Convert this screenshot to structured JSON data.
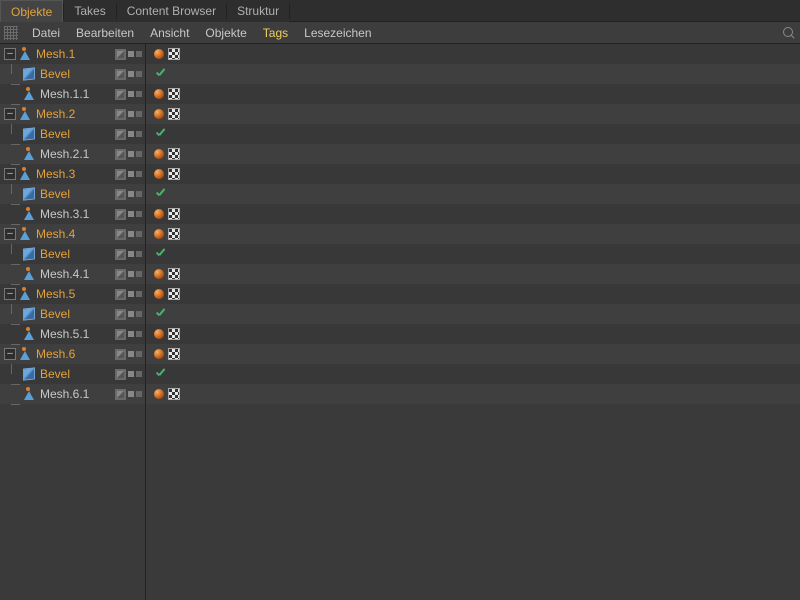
{
  "tabs": [
    {
      "label": "Objekte",
      "active": true
    },
    {
      "label": "Takes",
      "active": false
    },
    {
      "label": "Content Browser",
      "active": false
    },
    {
      "label": "Struktur",
      "active": false
    }
  ],
  "menu": {
    "items": [
      "Datei",
      "Bearbeiten",
      "Ansicht",
      "Objekte",
      "Tags",
      "Lesezeichen"
    ],
    "highlighted_index": 4
  },
  "expander_glyph": "–",
  "objects": [
    {
      "name": "Mesh.1",
      "type": "mesh",
      "depth": 0,
      "selected": true,
      "expanded": true,
      "tags": [
        "phong",
        "uvw"
      ]
    },
    {
      "name": "Bevel",
      "type": "bevel",
      "depth": 1,
      "selected": true,
      "expanded": false,
      "tags": [
        "check"
      ]
    },
    {
      "name": "Mesh.1.1",
      "type": "mesh",
      "depth": 1,
      "selected": false,
      "expanded": false,
      "tags": [
        "phong",
        "uvw"
      ],
      "last": true
    },
    {
      "name": "Mesh.2",
      "type": "mesh",
      "depth": 0,
      "selected": true,
      "expanded": true,
      "tags": [
        "phong",
        "uvw"
      ]
    },
    {
      "name": "Bevel",
      "type": "bevel",
      "depth": 1,
      "selected": true,
      "expanded": false,
      "tags": [
        "check"
      ]
    },
    {
      "name": "Mesh.2.1",
      "type": "mesh",
      "depth": 1,
      "selected": false,
      "expanded": false,
      "tags": [
        "phong",
        "uvw"
      ],
      "last": true
    },
    {
      "name": "Mesh.3",
      "type": "mesh",
      "depth": 0,
      "selected": true,
      "expanded": true,
      "tags": [
        "phong",
        "uvw"
      ]
    },
    {
      "name": "Bevel",
      "type": "bevel",
      "depth": 1,
      "selected": true,
      "expanded": false,
      "tags": [
        "check"
      ]
    },
    {
      "name": "Mesh.3.1",
      "type": "mesh",
      "depth": 1,
      "selected": false,
      "expanded": false,
      "tags": [
        "phong",
        "uvw"
      ],
      "last": true
    },
    {
      "name": "Mesh.4",
      "type": "mesh",
      "depth": 0,
      "selected": true,
      "expanded": true,
      "tags": [
        "phong",
        "uvw"
      ]
    },
    {
      "name": "Bevel",
      "type": "bevel",
      "depth": 1,
      "selected": true,
      "expanded": false,
      "tags": [
        "check"
      ]
    },
    {
      "name": "Mesh.4.1",
      "type": "mesh",
      "depth": 1,
      "selected": false,
      "expanded": false,
      "tags": [
        "phong",
        "uvw"
      ],
      "last": true
    },
    {
      "name": "Mesh.5",
      "type": "mesh",
      "depth": 0,
      "selected": true,
      "expanded": true,
      "tags": [
        "phong",
        "uvw"
      ]
    },
    {
      "name": "Bevel",
      "type": "bevel",
      "depth": 1,
      "selected": true,
      "expanded": false,
      "tags": [
        "check"
      ]
    },
    {
      "name": "Mesh.5.1",
      "type": "mesh",
      "depth": 1,
      "selected": false,
      "expanded": false,
      "tags": [
        "phong",
        "uvw"
      ],
      "last": true
    },
    {
      "name": "Mesh.6",
      "type": "mesh",
      "depth": 0,
      "selected": true,
      "expanded": true,
      "tags": [
        "phong",
        "uvw"
      ]
    },
    {
      "name": "Bevel",
      "type": "bevel",
      "depth": 1,
      "selected": true,
      "expanded": false,
      "tags": [
        "check"
      ]
    },
    {
      "name": "Mesh.6.1",
      "type": "mesh",
      "depth": 1,
      "selected": false,
      "expanded": false,
      "tags": [
        "phong",
        "uvw"
      ],
      "last": true
    }
  ]
}
